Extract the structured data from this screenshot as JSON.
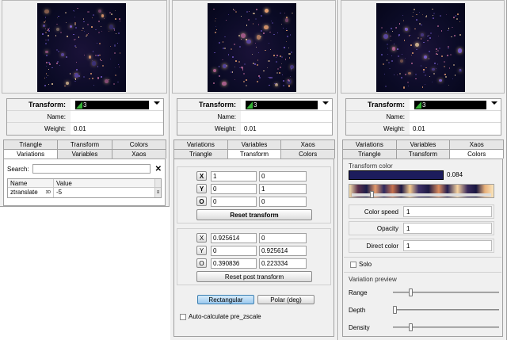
{
  "shared": {
    "transform_label": "Transform:",
    "transform_value": "3",
    "name_label": "Name:",
    "name_value": "",
    "weight_label": "Weight:",
    "weight_value": "0.01"
  },
  "panel1": {
    "tabs_row1": [
      "Triangle",
      "Transform",
      "Colors"
    ],
    "tabs_row2": [
      "Variations",
      "Variables",
      "Xaos"
    ],
    "active_tab": "Variations",
    "search_label": "Search:",
    "search_value": "",
    "table_headers": [
      "Name",
      "Value"
    ],
    "rows": [
      {
        "name": "ztranslate",
        "badge": "3D",
        "value": "-5"
      }
    ]
  },
  "panel2": {
    "tabs_row1": [
      "Variations",
      "Variables",
      "Xaos"
    ],
    "tabs_row2": [
      "Triangle",
      "Transform",
      "Colors"
    ],
    "active_tab": "Transform",
    "pre": [
      {
        "btn": "X",
        "a": "1",
        "b": "0"
      },
      {
        "btn": "Y",
        "a": "0",
        "b": "1"
      },
      {
        "btn": "O",
        "a": "0",
        "b": "0"
      }
    ],
    "reset_transform": "Reset transform",
    "post": [
      {
        "btn": "X",
        "a": "0.925614",
        "b": "0"
      },
      {
        "btn": "Y",
        "a": "0",
        "b": "0.925614"
      },
      {
        "btn": "O",
        "a": "0.390836",
        "b": "0.223334"
      }
    ],
    "reset_post": "Reset post transform",
    "rect_label": "Rectangular",
    "polar_label": "Polar (deg)",
    "auto_calc_label": "Auto-calculate pre_zscale"
  },
  "panel3": {
    "tabs_row1": [
      "Variations",
      "Variables",
      "Xaos"
    ],
    "tabs_row2": [
      "Triangle",
      "Transform",
      "Colors"
    ],
    "active_tab": "Colors",
    "transform_color_label": "Transform color",
    "transform_color_value": "0.084",
    "color_speed_label": "Color speed",
    "color_speed_value": "1",
    "opacity_label": "Opacity",
    "opacity_value": "1",
    "direct_color_label": "Direct color",
    "direct_color_value": "1",
    "solo_label": "Solo",
    "variation_preview_label": "Variation preview",
    "range_label": "Range",
    "depth_label": "Depth",
    "density_label": "Density",
    "range_level": 0.17,
    "depth_level": 0.0,
    "density_level": 0.17
  }
}
